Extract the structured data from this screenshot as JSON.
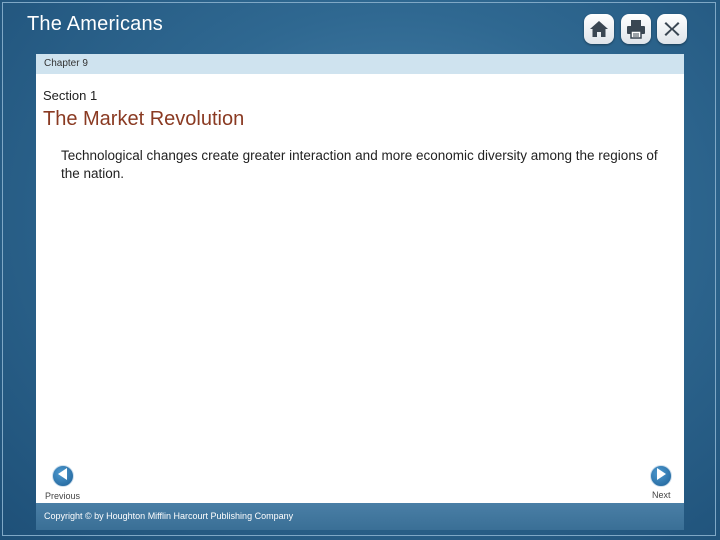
{
  "app": {
    "title": "The Americans"
  },
  "toolbar": {
    "home_icon": "home-icon",
    "print_icon": "print-icon",
    "close_icon": "close-icon"
  },
  "slide": {
    "chapter": "Chapter 9",
    "section": "Section 1",
    "title": "The Market Revolution",
    "body": "Technological changes create greater interaction and more economic diversity among the regions of the nation."
  },
  "navigation": {
    "previous_label": "Previous",
    "next_label": "Next"
  },
  "footer": {
    "copyright": "Copyright © by Houghton Mifflin Harcourt Publishing Company"
  },
  "colors": {
    "background": "#2f6891",
    "title_accent": "#8a3a22",
    "chapter_bar": "#cfe3ef",
    "footer_bar": "#3a6f96"
  }
}
